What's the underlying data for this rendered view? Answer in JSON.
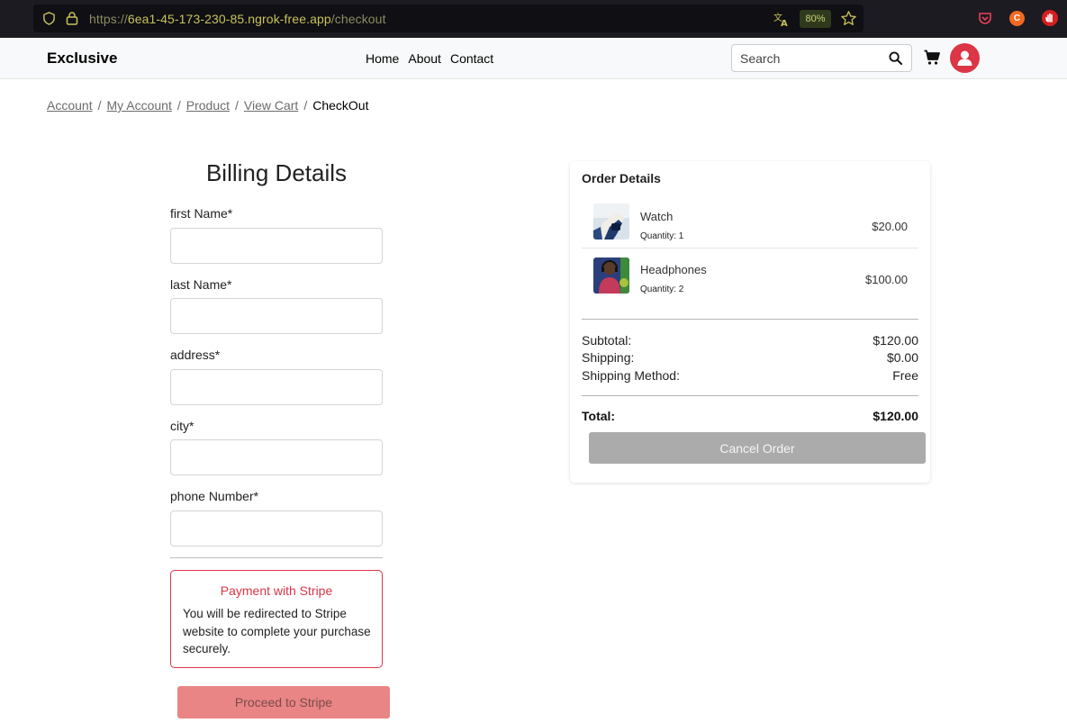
{
  "browser": {
    "url_scheme": "https://",
    "url_host": "6ea1-45-173-230-85.ngrok-free.app",
    "url_path": "/checkout",
    "zoom": "80%",
    "extension_badge": "C"
  },
  "nav": {
    "brand": "Exclusive",
    "links": [
      "Home",
      "About",
      "Contact"
    ],
    "search_placeholder": "Search"
  },
  "breadcrumb": [
    "Account",
    "My Account",
    "Product",
    "View Cart",
    "CheckOut"
  ],
  "billing": {
    "title": "Billing Details",
    "fields": [
      {
        "label": "first Name*",
        "value": ""
      },
      {
        "label": "last Name*",
        "value": ""
      },
      {
        "label": "address*",
        "value": ""
      },
      {
        "label": "city*",
        "value": ""
      },
      {
        "label": "phone Number*",
        "value": ""
      }
    ],
    "stripe_title": "Payment with Stripe",
    "stripe_text": "You will be redirected to Stripe website to complete your purchase securely.",
    "proceed_label": "Proceed to Stripe"
  },
  "order": {
    "title": "Order Details",
    "items": [
      {
        "name": "Watch",
        "qty": "Quantity: 1",
        "price": "$20.00"
      },
      {
        "name": "Headphones",
        "qty": "Quantity: 2",
        "price": "$100.00"
      }
    ],
    "subtotal_label": "Subtotal:",
    "subtotal_value": "$120.00",
    "shipping_label": "Shipping:",
    "shipping_value": "$0.00",
    "method_label": "Shipping Method:",
    "method_value": "Free",
    "total_label": "Total:",
    "total_value": "$120.00",
    "cancel_label": "Cancel Order"
  },
  "colors": {
    "accent": "#dc3545",
    "proceed_button": "#ea8585",
    "cancel_button": "#ababab"
  }
}
